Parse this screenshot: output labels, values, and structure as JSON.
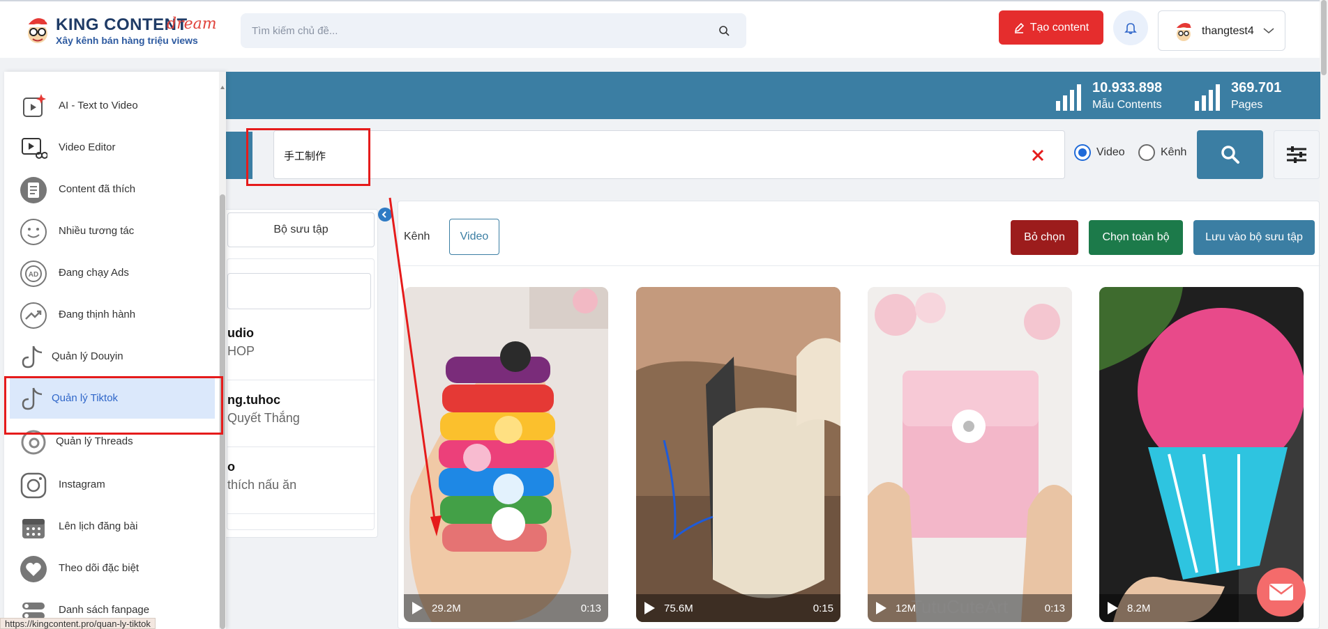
{
  "header": {
    "brand": "KING CONTENT",
    "brand_script": "dream",
    "tagline": "Xây kênh bán hàng triệu views",
    "search_placeholder": "Tìm kiếm chủ đề...",
    "create_label": "Tạo content",
    "username": "thangtest4"
  },
  "stats": [
    {
      "value": "10.933.898",
      "label": "Mẫu Contents"
    },
    {
      "value": "369.701",
      "label": "Pages"
    }
  ],
  "search": {
    "query": "手工制作",
    "options": [
      {
        "label": "Video",
        "selected": true
      },
      {
        "label": "Kênh",
        "selected": false
      }
    ]
  },
  "left_panel": {
    "collection_tab": "Bộ sưu tập",
    "entries": [
      {
        "name": "udio",
        "sub": "HOP"
      },
      {
        "name": "ng.tuhoc",
        "sub": "Quyết Thắng"
      },
      {
        "name": "o",
        "sub": "thích nấu ăn"
      }
    ]
  },
  "content": {
    "tabs": [
      "Kênh",
      "Video"
    ],
    "active_tab": "Video",
    "actions": {
      "deselect": "Bỏ chọn",
      "select_all": "Chọn toàn bộ",
      "save": "Lưu vào bộ sưu tập"
    },
    "action_colors": {
      "deselect": "#9c1c1c",
      "select_all": "#1c7a4a",
      "save": "#3b7ea3"
    },
    "videos": [
      {
        "views": "29.2M",
        "duration": "0:13",
        "watermark": ""
      },
      {
        "views": "75.6M",
        "duration": "0:15",
        "watermark": ""
      },
      {
        "views": "12M",
        "duration": "0:13",
        "watermark": "TutuCuteArt"
      },
      {
        "views": "8.2M",
        "duration": "",
        "watermark": ""
      }
    ]
  },
  "sidebar": {
    "items": [
      {
        "label": "AI - Text to Video",
        "icon": "ai-video-icon"
      },
      {
        "label": "Video Editor",
        "icon": "video-editor-icon"
      },
      {
        "label": "Content đã thích",
        "icon": "liked-content-icon"
      },
      {
        "label": "Nhiều tương tác",
        "icon": "smile-icon"
      },
      {
        "label": "Đang chạy Ads",
        "icon": "ads-icon"
      },
      {
        "label": "Đang thịnh hành",
        "icon": "trending-icon"
      },
      {
        "label": "Quản lý Douyin",
        "icon": "douyin-icon"
      },
      {
        "label": "Quản lý Tiktok",
        "icon": "tiktok-icon"
      },
      {
        "label": "Quản lý Threads",
        "icon": "threads-icon"
      },
      {
        "label": "Instagram",
        "icon": "instagram-icon"
      },
      {
        "label": "Lên lịch đăng bài",
        "icon": "calendar-icon"
      },
      {
        "label": "Theo dõi đặc biệt",
        "icon": "heart-icon"
      },
      {
        "label": "Danh sách fanpage",
        "icon": "fanpage-list-icon"
      }
    ],
    "active_index": 7
  },
  "status_url": "https://kingcontent.pro/quan-ly-tiktok",
  "colors": {
    "primary": "#3b7ea3",
    "danger": "#e52d2d",
    "highlight": "#e51b1b"
  }
}
